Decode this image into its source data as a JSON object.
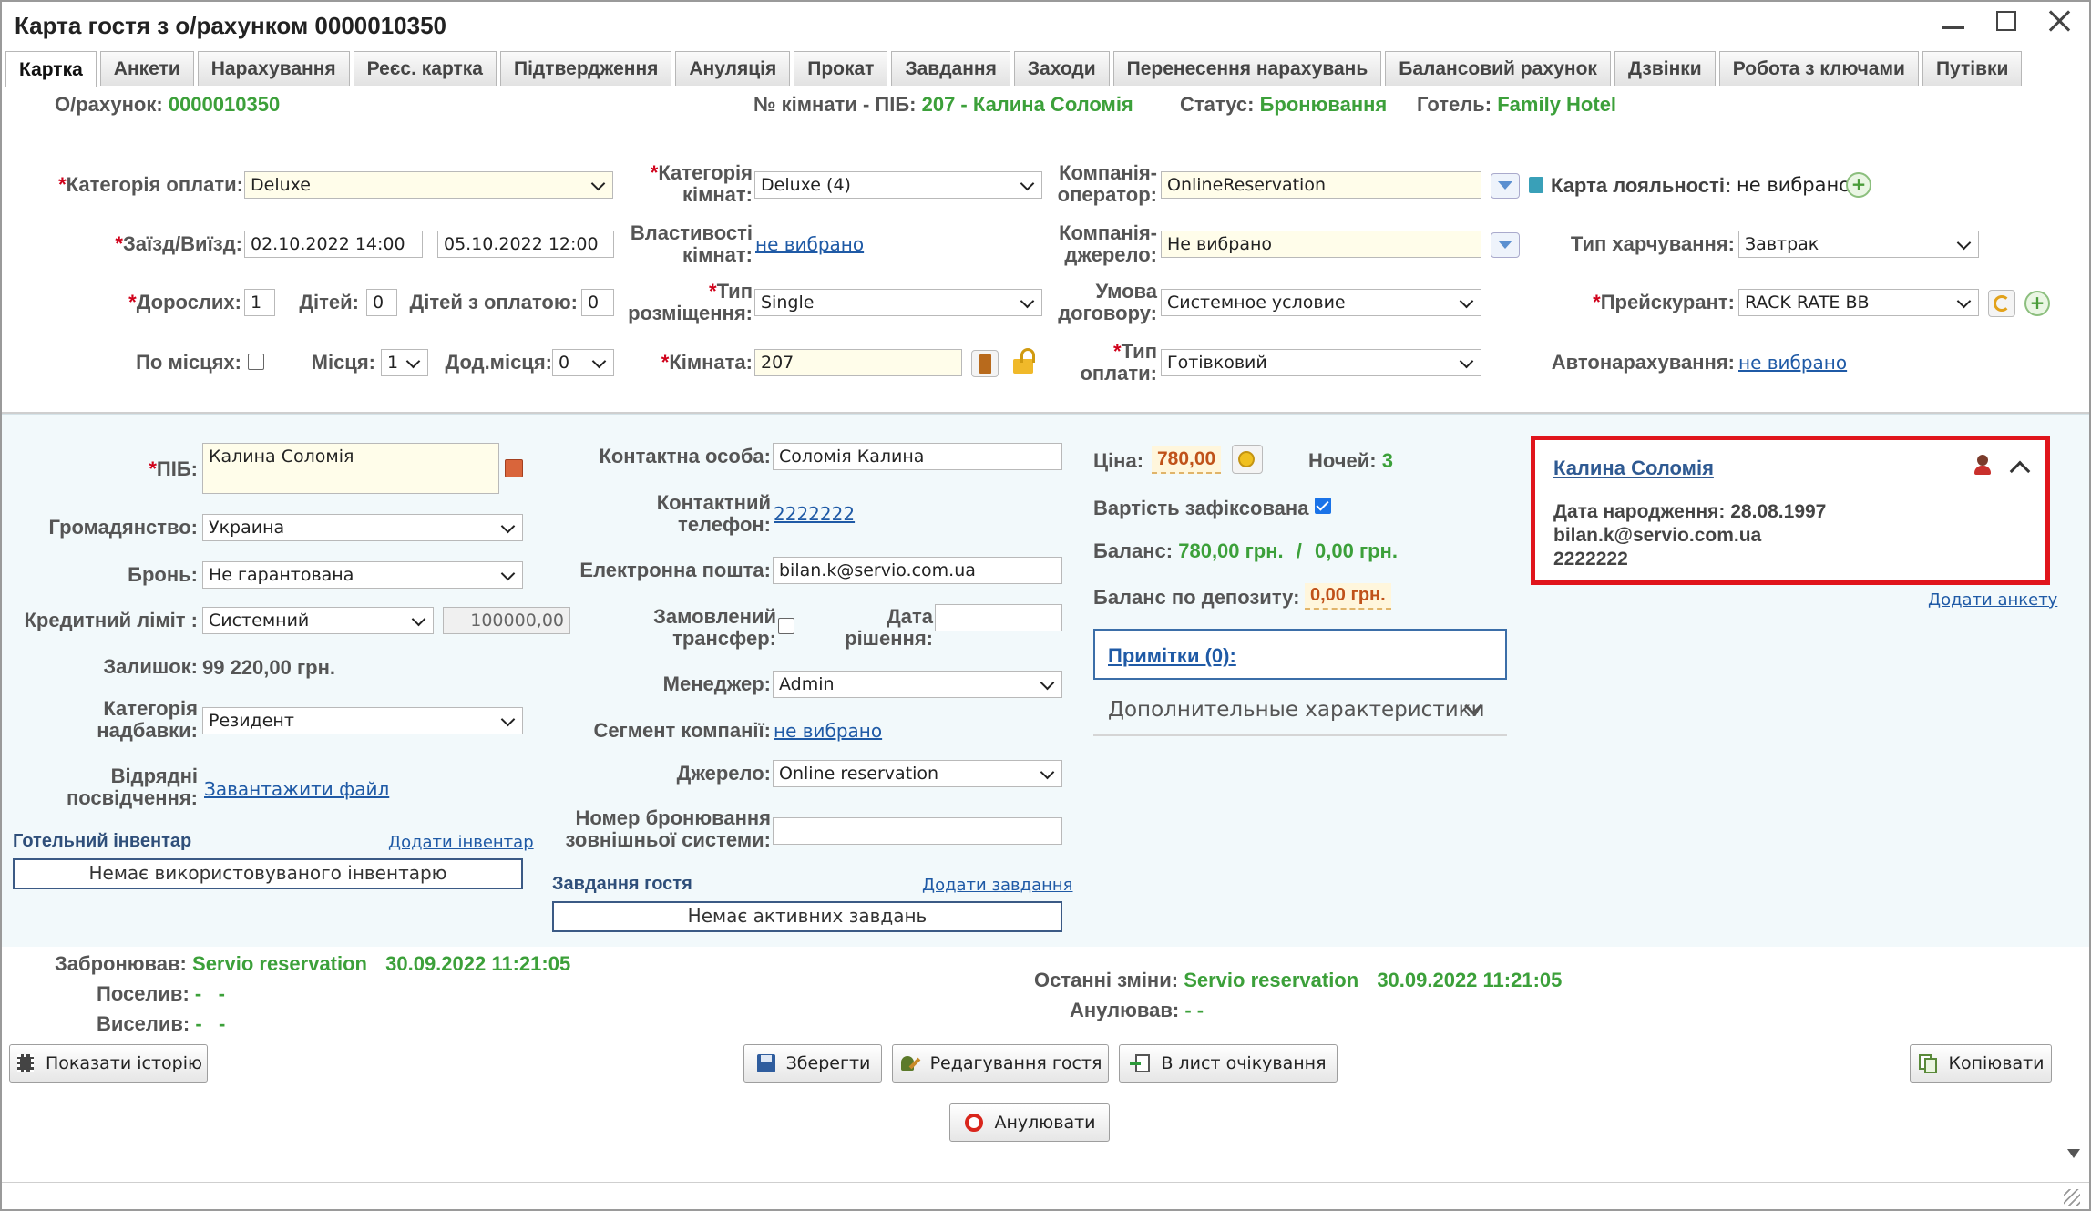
{
  "window": {
    "title": "Карта гостя з о/рахунком 0000010350"
  },
  "tabs": [
    "Картка",
    "Анкети",
    "Нарахування",
    "Реєс. картка",
    "Підтвердження",
    "Ануляція",
    "Прокат",
    "Завдання",
    "Заходи",
    "Перенесення нарахувань",
    "Балансовий рахунок",
    "Дзвінки",
    "Робота з ключами",
    "Путівки"
  ],
  "header": {
    "account_label": "О/рахунок:",
    "account_value": "0000010350",
    "room_label": "№ кімнати - ПІБ:",
    "room_value": "207 - Калина Соломія",
    "status_label": "Статус:",
    "status_value": "Бронювання",
    "hotel_label": "Готель:",
    "hotel_value": "Family Hotel"
  },
  "form": {
    "pay_category_label": "Категорія оплати:",
    "pay_category_value": "Deluxe",
    "room_category_label_1": "Категорія",
    "room_category_label_2": "кімнат:",
    "room_category_value": "Deluxe (4)",
    "operator_label_1": "Компанія-",
    "operator_label_2": "оператор:",
    "operator_value": "OnlineReservation",
    "loyalty_label": "Карта лояльності:",
    "loyalty_value": "не вибрано",
    "checkin_label": "Заїзд/Виїзд:",
    "checkin_value": "02.10.2022 14:00",
    "checkout_value": "05.10.2022 12:00",
    "room_props_label_1": "Властивості",
    "room_props_label_2": "кімнат:",
    "room_props_value": "не вибрано",
    "source_company_label_1": "Компанія-",
    "source_company_label_2": "джерело:",
    "source_company_value": "Не вибрано",
    "meal_label": "Тип харчування:",
    "meal_value": "Завтрак",
    "adults_label": "Дорослих:",
    "adults_value": "1",
    "children_label": "Дітей:",
    "children_value": "0",
    "paid_children_label": "Дітей з оплатою:",
    "paid_children_value": "0",
    "placement_label_1": "Тип",
    "placement_label_2": "розміщення:",
    "placement_value": "Single",
    "contract_label_1": "Умова",
    "contract_label_2": "договору:",
    "contract_value": "Системное условие",
    "pricelist_label": "Прейскурант:",
    "pricelist_value": "RACK RATE BB",
    "by_places_label": "По місцях:",
    "places_label": "Місця:",
    "places_value": "1",
    "extra_places_label": "Дод.місця:",
    "extra_places_value": "0",
    "room_label": "Кімната:",
    "room_value": "207",
    "pay_type_label_1": "Тип",
    "pay_type_label_2": "оплати:",
    "pay_type_value": "Готівковий",
    "auto_charge_label": "Автонарахування:",
    "auto_charge_value": "не вибрано"
  },
  "guest": {
    "name_label": "ПІБ:",
    "name_value": "Калина Соломія",
    "citizenship_label": "Громадянство:",
    "citizenship_value": "Украина",
    "booking_label": "Бронь:",
    "booking_value": "Не гарантована",
    "credit_label": "Кредитний ліміт :",
    "credit_value": "Системний",
    "credit_amount": "100000,00",
    "remainder_label": "Залишок:",
    "remainder_value": "99 220,00 грн.",
    "surcharge_label_1": "Категорія",
    "surcharge_label_2": "надбавки:",
    "surcharge_value": "Резидент",
    "docs_label_1": "Відрядні",
    "docs_label_2": "посвідчення:",
    "docs_link": "Завантажити файл",
    "inventory_title": "Готельний інвентар",
    "inventory_add": "Додати інвентар",
    "inventory_empty": "Немає використовуваного інвентарю"
  },
  "contact": {
    "person_label": "Контактна особа:",
    "person_value": "Соломія Калина",
    "phone_label_1": "Контактний",
    "phone_label_2": "телефон:",
    "phone_value": "2222222",
    "email_label": "Електронна пошта:",
    "email_value": "bilan.k@servio.com.ua",
    "transfer_label_1": "Замовлений",
    "transfer_label_2": "трансфер:",
    "decision_label_1": "Дата",
    "decision_label_2": "рішення:",
    "manager_label": "Менеджер:",
    "manager_value": "Admin",
    "segment_label": "Сегмент компанії:",
    "segment_value": "не вибрано",
    "source_label": "Джерело:",
    "source_value": "Online reservation",
    "ext_booking_label_1": "Номер бронювання",
    "ext_booking_label_2": "зовнішньої системи:",
    "tasks_title": "Завдання гостя",
    "tasks_add": "Додати завдання",
    "tasks_empty": "Немає активних завдань"
  },
  "pricing": {
    "price_label": "Ціна:",
    "price_value": "780,00",
    "nights_label": "Ночей:",
    "nights_value": "3",
    "fixed_label": "Вартість зафіксована",
    "balance_label": "Баланс:",
    "balance_value": "780,00 грн.",
    "balance_sep": "/",
    "balance_value2": "0,00 грн.",
    "deposit_label": "Баланс по депозиту:",
    "deposit_value": "0,00 грн.",
    "notes_label": "Примітки (0):",
    "extra_label": "Дополнительные характеристики"
  },
  "guest_card": {
    "name": "Калина Соломія",
    "birth": "Дата народження: 28.08.1997",
    "email": "bilan.k@servio.com.ua",
    "phone": "2222222",
    "add_profile": "Додати анкету"
  },
  "footer": {
    "booked_label": "Забронював:",
    "booked_by": "Servio reservation",
    "booked_at": "30.09.2022 11:21:05",
    "settled_label": "Поселив:",
    "settled_value": "-   -",
    "evicted_label": "Виселив:",
    "evicted_value": "-   -",
    "changed_label": "Останні зміни:",
    "changed_by": "Servio reservation",
    "changed_at": "30.09.2022 11:21:05",
    "cancelled_label": "Анулював:",
    "cancelled_value": "- -"
  },
  "buttons": {
    "history": "Показати історію",
    "save": "Зберегти",
    "edit_guest": "Редагування гостя",
    "waitlist": "В лист очікування",
    "copy": "Копіювати",
    "cancel": "Анулювати"
  }
}
